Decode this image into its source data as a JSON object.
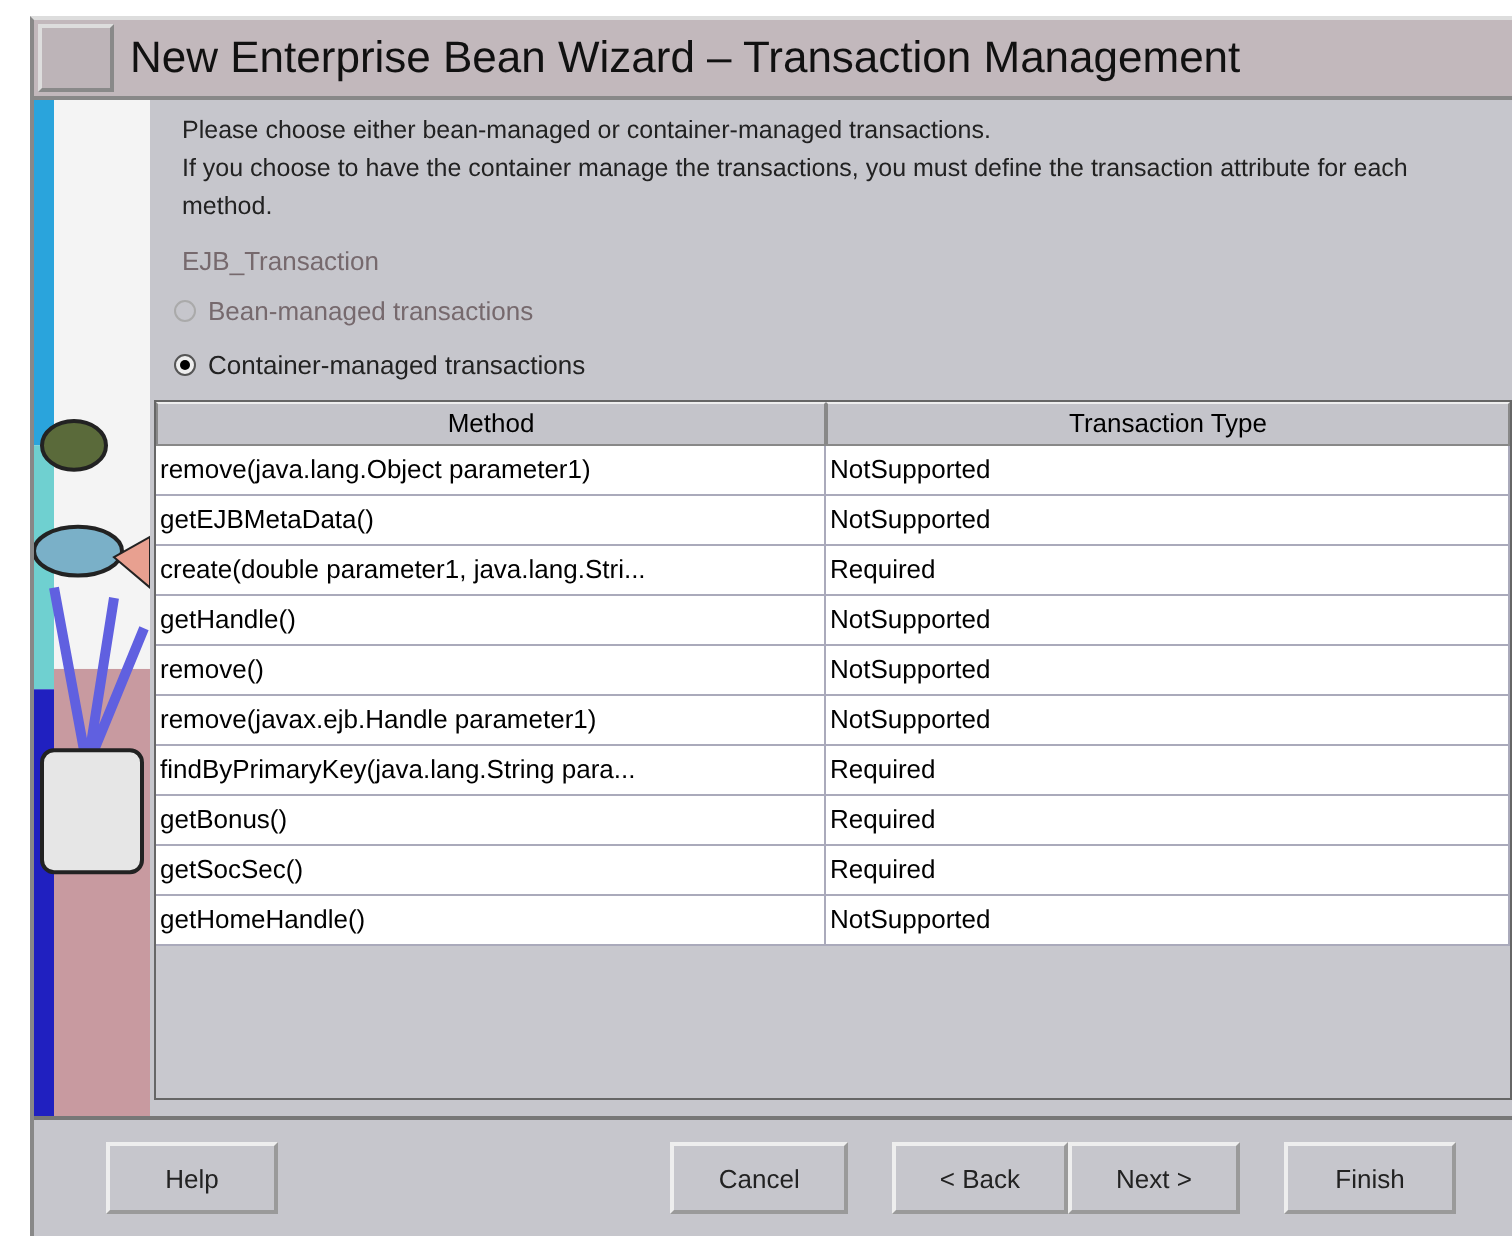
{
  "window": {
    "title": "New Enterprise Bean Wizard – Transaction Management"
  },
  "intro": [
    "Please choose either bean-managed or container-managed transactions.",
    "If you choose to have the container manage the transactions, you must define the transaction attribute for each method."
  ],
  "group": {
    "label": "EJB_Transaction",
    "disabled": true
  },
  "options": [
    {
      "label": "Bean-managed transactions",
      "selected": false,
      "disabled": true
    },
    {
      "label": "Container-managed transactions",
      "selected": true,
      "disabled": false
    }
  ],
  "table": {
    "columns": [
      "Method",
      "Transaction Type"
    ],
    "rows": [
      [
        "remove(java.lang.Object parameter1)",
        "NotSupported"
      ],
      [
        "getEJBMetaData()",
        "NotSupported"
      ],
      [
        "create(double parameter1, java.lang.Stri...",
        "Required"
      ],
      [
        "getHandle()",
        "NotSupported"
      ],
      [
        "remove()",
        "NotSupported"
      ],
      [
        "remove(javax.ejb.Handle parameter1)",
        "NotSupported"
      ],
      [
        "findByPrimaryKey(java.lang.String para...",
        "Required"
      ],
      [
        "getBonus()",
        "Required"
      ],
      [
        "getSocSec()",
        "Required"
      ],
      [
        "getHomeHandle()",
        "NotSupported"
      ]
    ]
  },
  "button_groups": [
    [
      "Help"
    ],
    [
      "Cancel"
    ],
    [
      "< Back",
      "Next >"
    ],
    [
      "Finish"
    ]
  ]
}
